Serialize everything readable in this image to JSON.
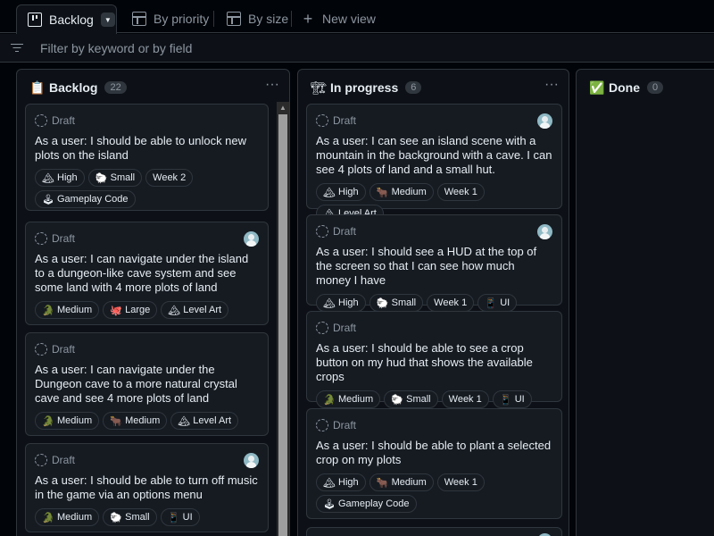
{
  "tabs": [
    {
      "label": "Backlog",
      "icon": "board-icon",
      "active": true
    },
    {
      "label": "By priority",
      "icon": "table-icon"
    },
    {
      "label": "By size",
      "icon": "table-icon"
    },
    {
      "label": "New view",
      "icon": "plus-icon"
    }
  ],
  "filter": {
    "placeholder": "Filter by keyword or by field"
  },
  "columns": [
    {
      "title": "Backlog",
      "emoji": "📋",
      "count": "22",
      "cards": [
        {
          "status": "Draft",
          "avatar": false,
          "title": "As a user: I should be able to unlock new plots on the island",
          "labels": [
            {
              "icon": "🏔",
              "text": "High"
            },
            {
              "icon": "🐑",
              "text": "Small"
            },
            {
              "icon": "",
              "text": "Week 2"
            },
            {
              "icon": "🕹",
              "text": "Gameplay Code"
            }
          ]
        },
        {
          "status": "Draft",
          "avatar": true,
          "title": "As a user: I can navigate under the island to a dungeon-like cave system and see some land with 4 more plots of land",
          "labels": [
            {
              "icon": "🐊",
              "text": "Medium"
            },
            {
              "icon": "🐙",
              "text": "Large"
            },
            {
              "icon": "🏔",
              "text": "Level Art"
            }
          ]
        },
        {
          "status": "Draft",
          "avatar": false,
          "title": "As a user: I can navigate under the Dungeon cave to a more natural crystal cave and see 4 more plots of land",
          "labels": [
            {
              "icon": "🐊",
              "text": "Medium"
            },
            {
              "icon": "🐂",
              "text": "Medium"
            },
            {
              "icon": "🏔",
              "text": "Level Art"
            }
          ]
        },
        {
          "status": "Draft",
          "avatar": true,
          "title": "As a user: I should be able to turn off music in the game via an options menu",
          "labels": [
            {
              "icon": "🐊",
              "text": "Medium"
            },
            {
              "icon": "🐑",
              "text": "Small"
            },
            {
              "icon": "📱",
              "text": "UI"
            }
          ]
        }
      ]
    },
    {
      "title": "In progress",
      "emoji": "🏗",
      "count": "6",
      "cards": [
        {
          "status": "Draft",
          "avatar": true,
          "title": "As a user: I can see an island scene with a mountain in the background with a cave. I can see 4 plots of land and a small hut.",
          "labels": [
            {
              "icon": "🏔",
              "text": "High"
            },
            {
              "icon": "🐂",
              "text": "Medium"
            },
            {
              "icon": "",
              "text": "Week 1"
            },
            {
              "icon": "🏔",
              "text": "Level Art"
            }
          ]
        },
        {
          "status": "Draft",
          "avatar": true,
          "title": "As a user: I should see a HUD at the top of the screen so that I can see how much money I have",
          "labels": [
            {
              "icon": "🏔",
              "text": "High"
            },
            {
              "icon": "🐑",
              "text": "Small"
            },
            {
              "icon": "",
              "text": "Week 1"
            },
            {
              "icon": "📱",
              "text": "UI"
            }
          ]
        },
        {
          "status": "Draft",
          "avatar": false,
          "title": "As a user: I should be able to see a crop button on my hud that shows the available crops",
          "labels": [
            {
              "icon": "🐊",
              "text": "Medium"
            },
            {
              "icon": "🐑",
              "text": "Small"
            },
            {
              "icon": "",
              "text": "Week 1"
            },
            {
              "icon": "📱",
              "text": "UI"
            }
          ]
        },
        {
          "status": "Draft",
          "avatar": false,
          "title": "As a user: I should be able to plant a selected crop on my plots",
          "labels": [
            {
              "icon": "🏔",
              "text": "High"
            },
            {
              "icon": "🐂",
              "text": "Medium"
            },
            {
              "icon": "",
              "text": "Week 1"
            },
            {
              "icon": "🕹",
              "text": "Gameplay Code"
            }
          ]
        },
        {
          "status": "",
          "avatar": true,
          "title": "",
          "labels": []
        }
      ]
    },
    {
      "title": "Done",
      "emoji": "✅",
      "count": "0",
      "cards": []
    }
  ]
}
